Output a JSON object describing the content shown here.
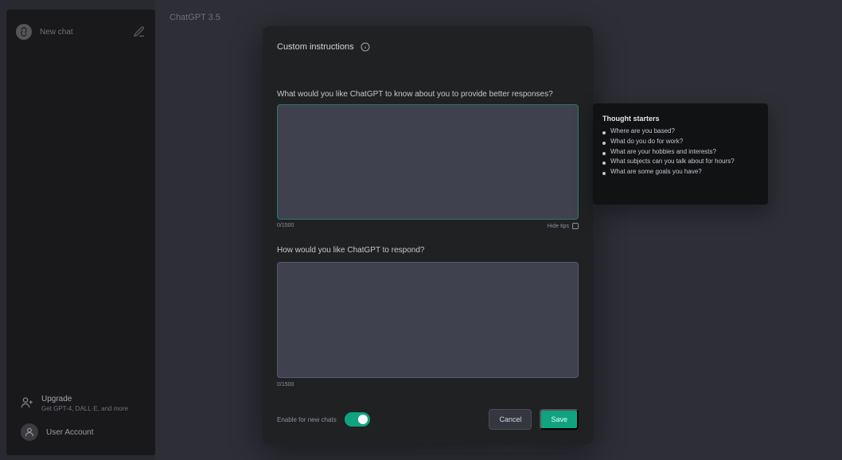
{
  "sidebar": {
    "new_chat_label": "New chat",
    "upgrade": {
      "title": "Upgrade",
      "subtitle": "Get GPT-4, DALL·E, and more"
    },
    "user": {
      "name": "User Account"
    }
  },
  "main": {
    "model_label": "ChatGPT 3.5"
  },
  "modal": {
    "title": "Custom instructions",
    "q1_label": "What would you like ChatGPT to know about you to provide better responses?",
    "q1_count": "0/1500",
    "hide_tips_label": "Hide tips",
    "q2_label": "How would you like ChatGPT to respond?",
    "q2_count": "0/1500",
    "enable_label": "Enable for new chats",
    "cancel_label": "Cancel",
    "save_label": "Save"
  },
  "tooltip": {
    "title": "Thought starters",
    "items": [
      "Where are you based?",
      "What do you do for work?",
      "What are your hobbies and interests?",
      "What subjects can you talk about for hours?",
      "What are some goals you have?"
    ]
  },
  "colors": {
    "accent": "#10a37f",
    "modal_bg": "#202123",
    "field_bg": "#40414f"
  },
  "icons": {
    "logo": "openai-logo-icon",
    "edit": "edit-icon",
    "info": "info-icon",
    "upgrade": "user-plus-icon",
    "avatar": "user-icon"
  }
}
